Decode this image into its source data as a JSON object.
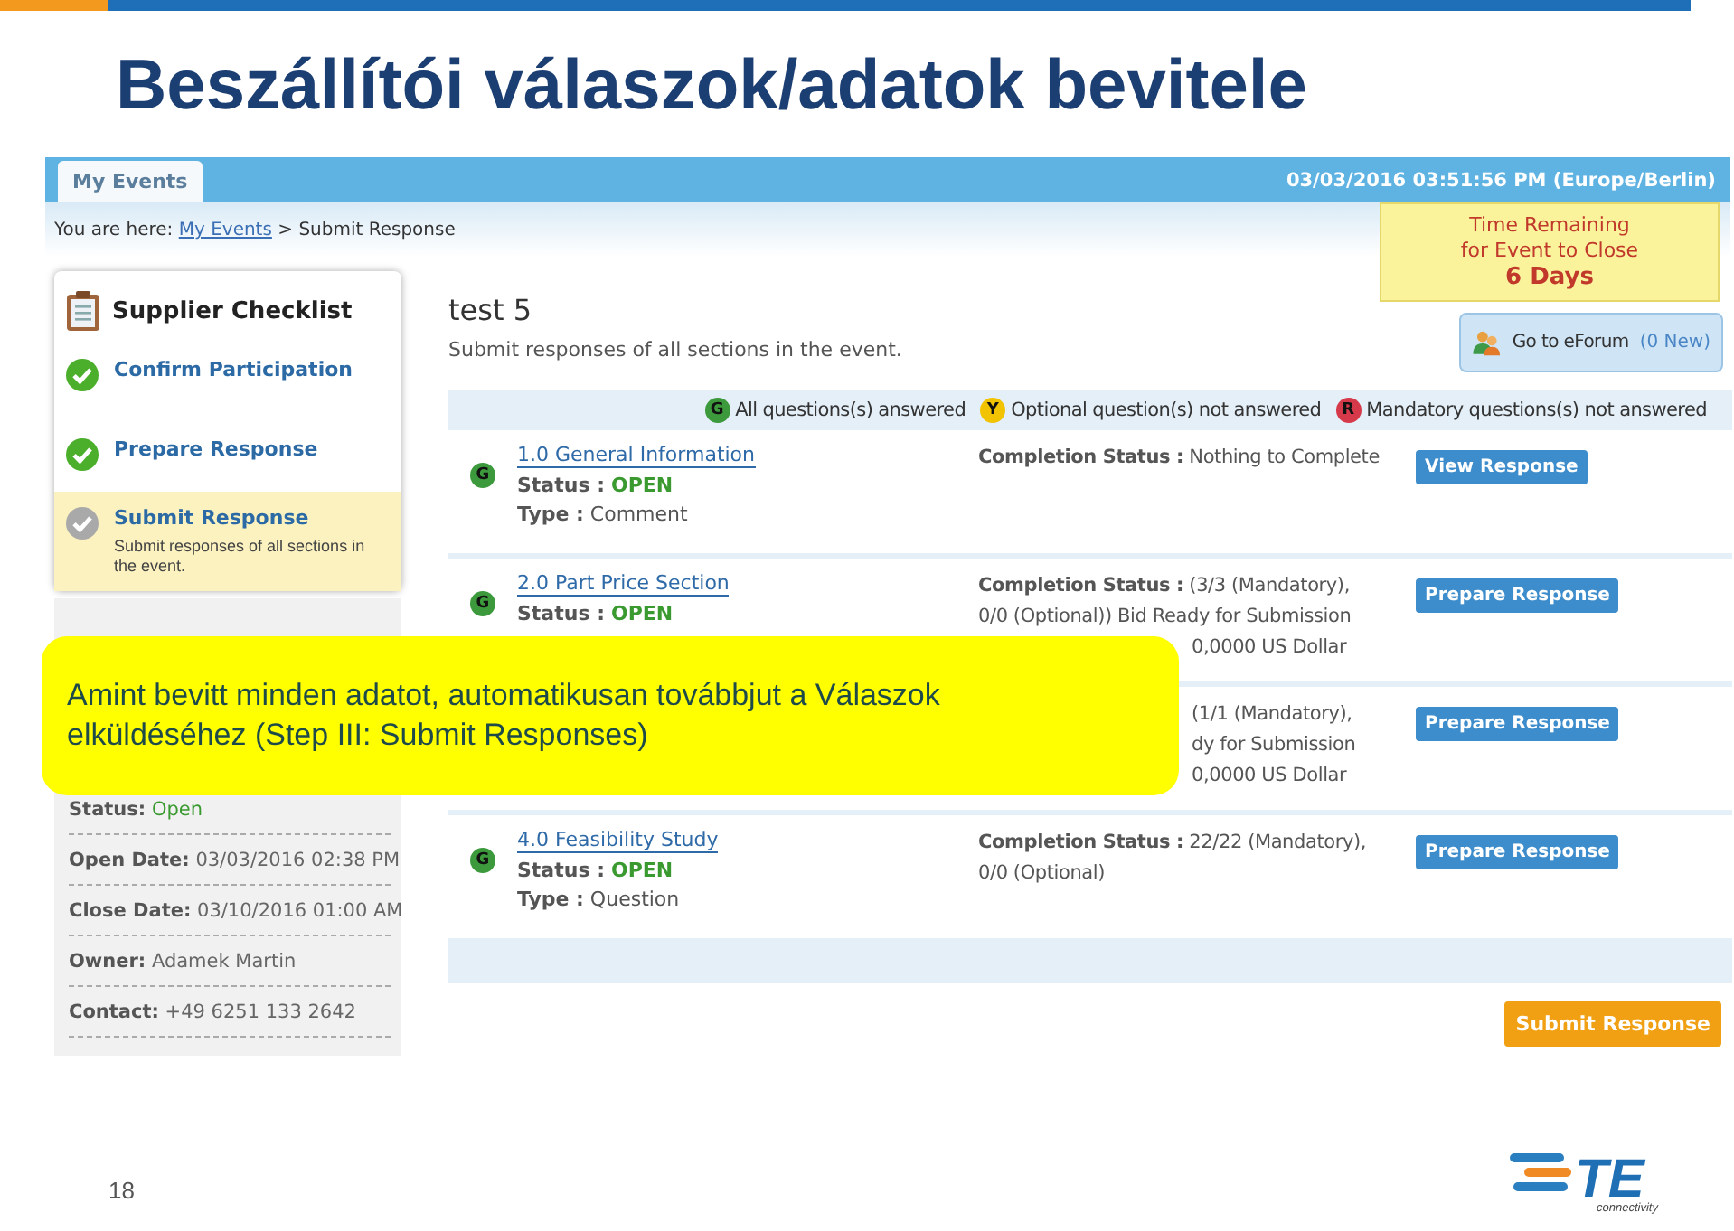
{
  "slide": {
    "title": "Beszállítói válaszok/adatok bevitele",
    "page_number": "18",
    "callout": "Amint bevitt minden adatot, automatikusan továbbjut a Válaszok elküldéséhez (Step III: Submit Responses)",
    "logo": {
      "mark": "TE",
      "tagline": "connectivity"
    }
  },
  "app": {
    "tabs": [
      {
        "label": "My Events",
        "selected": true
      }
    ],
    "datetime": "03/03/2016 03:51:56 PM (Europe/Berlin)",
    "breadcrumb": {
      "prefix": "You are here:",
      "link": "My Events",
      "current": "> Submit Response"
    },
    "checklist": {
      "title": "Supplier Checklist",
      "steps": [
        {
          "label": "Confirm Participation",
          "done": true,
          "selected": false
        },
        {
          "label": "Prepare Response",
          "done": true,
          "selected": false
        },
        {
          "label": "Submit Response",
          "done": false,
          "selected": true,
          "description": "Submit responses of all sections in the event."
        }
      ]
    },
    "event_info": [
      {
        "label": "Status:",
        "value": "Open",
        "kind": "status"
      },
      {
        "label": "Open Date:",
        "value": "03/03/2016 02:38 PM",
        "kind": "plain"
      },
      {
        "label": "Close Date:",
        "value": "03/10/2016 01:00 AM",
        "kind": "plain"
      },
      {
        "label": "Owner:",
        "value": "Adamek Martin",
        "kind": "plain"
      },
      {
        "label": "Contact:",
        "value": "+49 6251 133 2642",
        "kind": "plain"
      }
    ],
    "event": {
      "title": "test 5",
      "subtitle": "Submit responses of all sections in the event."
    },
    "time_remaining": {
      "lines": [
        "Time Remaining",
        "for Event to Close"
      ],
      "value": "6 Days"
    },
    "eforum": {
      "label": "Go to eForum",
      "count": "(0 New)"
    },
    "legend": [
      {
        "badge": "G",
        "text": "All questions(s) answered",
        "color": "#3c9a3c"
      },
      {
        "badge": "Y",
        "text": "Optional question(s) not answered",
        "color": "#f2c300"
      },
      {
        "badge": "R",
        "text": "Mandatory questions(s) not answered",
        "color": "#d63a4a"
      }
    ],
    "sections": [
      {
        "badge": "G",
        "color": "#3c9a3c",
        "link": "1.0 General Information",
        "status_label": "Status :",
        "status": "OPEN",
        "type_label": "Type :",
        "type": "Comment",
        "completion": [
          {
            "text": "**Completion Status :** Nothing to Complete",
            "kind": "full"
          }
        ],
        "button": "View Response"
      },
      {
        "badge": "G",
        "color": "#3c9a3c",
        "link": "2.0 Part Price Section",
        "status_label": "Status :",
        "status": "OPEN",
        "completion": [
          {
            "text": "**Completion Status :** (3/3 (Mandatory),",
            "kind": "full"
          },
          {
            "text": "0/0 (Optional)) Bid Ready for Submission",
            "kind": "full"
          },
          {
            "text": "0,0000 US Dollar",
            "kind": "clipped"
          }
        ],
        "button": "Prepare Response"
      },
      {
        "completion": [
          {
            "text": "(1/1 (Mandatory),",
            "kind": "clipped"
          },
          {
            "text": "dy for Submission",
            "kind": "clipped"
          },
          {
            "text": "0,0000 US Dollar",
            "kind": "clipped"
          }
        ],
        "button": "Prepare Response"
      },
      {
        "badge": "G",
        "color": "#3c9a3c",
        "link": "4.0 Feasibility Study",
        "status_label": "Status :",
        "status": "OPEN",
        "type_label": "Type :",
        "type": "Question",
        "completion": [
          {
            "text": "**Completion Status :** 22/22 (Mandatory),",
            "kind": "full"
          },
          {
            "text": "0/0 (Optional)",
            "kind": "full"
          }
        ],
        "button": "Prepare Response"
      }
    ],
    "submit_button": "Submit Response"
  }
}
